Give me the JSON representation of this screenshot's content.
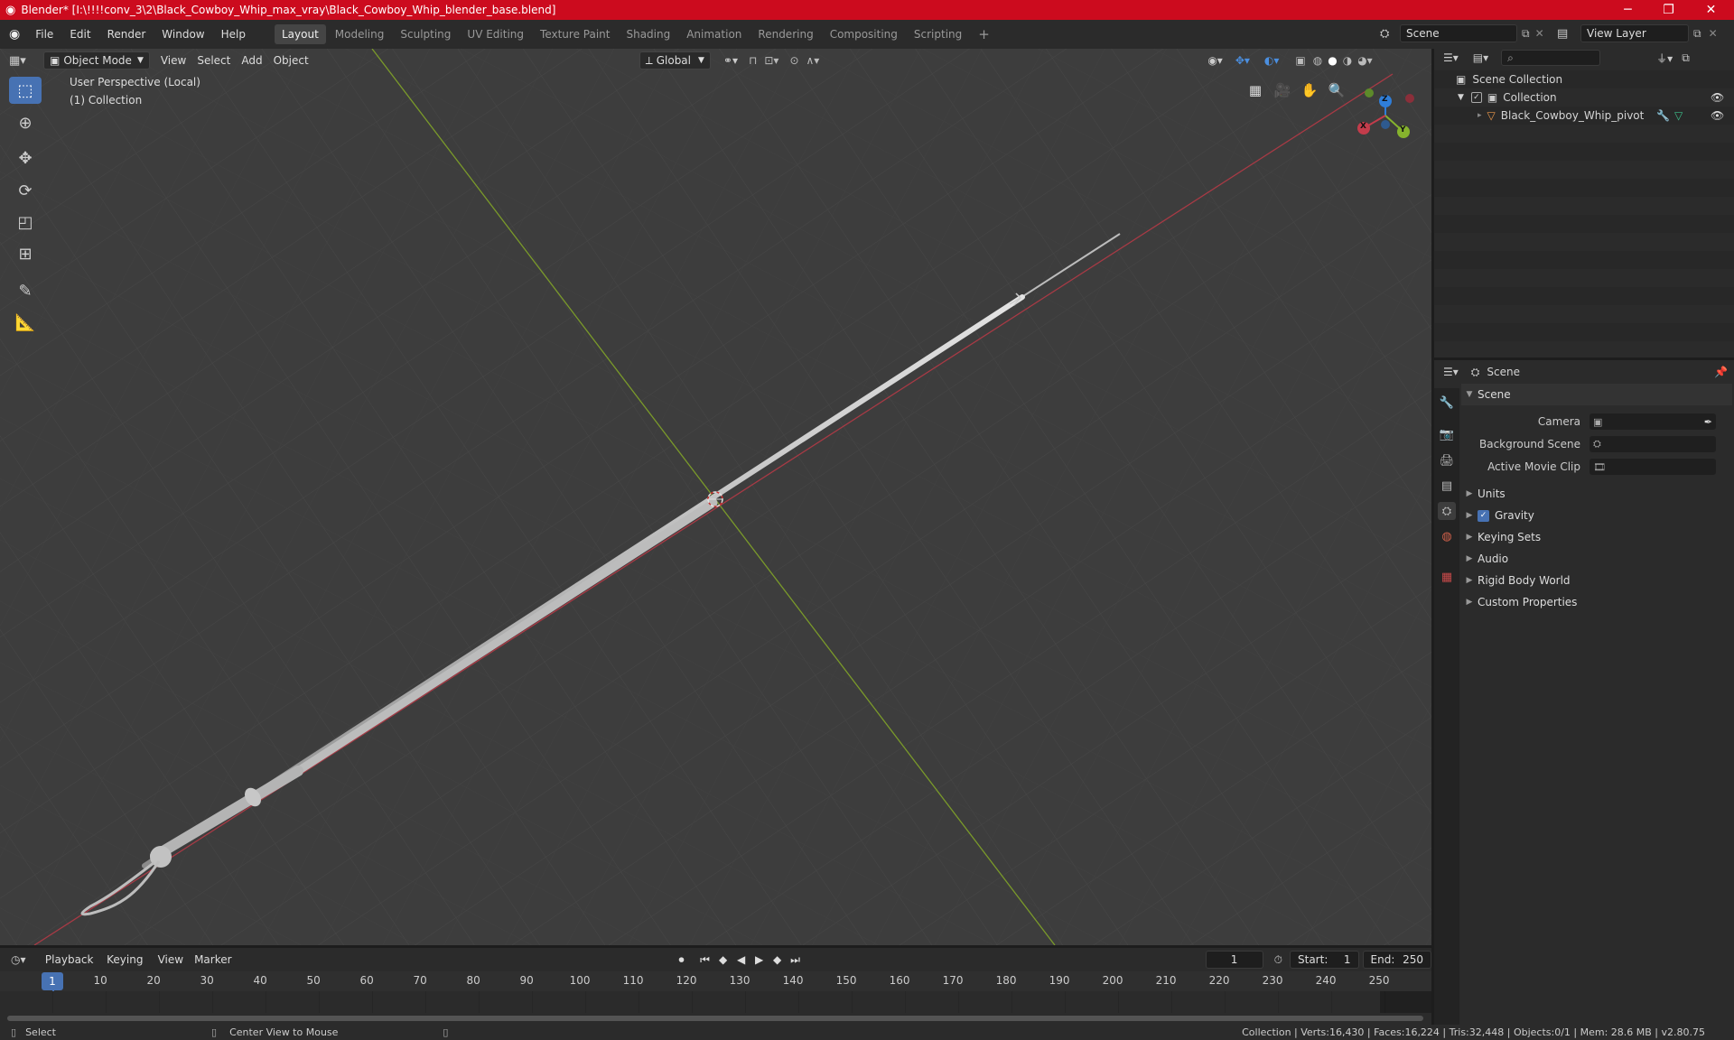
{
  "window": {
    "title": "Blender* [I:\\!!!!conv_3\\2\\Black_Cowboy_Whip_max_vray\\Black_Cowboy_Whip_blender_base.blend]",
    "minimize": "─",
    "maximize": "❐",
    "close": "✕"
  },
  "menus": [
    "File",
    "Edit",
    "Render",
    "Window",
    "Help"
  ],
  "workspaces": [
    "Layout",
    "Modeling",
    "Sculpting",
    "UV Editing",
    "Texture Paint",
    "Shading",
    "Animation",
    "Rendering",
    "Compositing",
    "Scripting"
  ],
  "active_workspace": "Layout",
  "add_workspace": "+",
  "scene_field": "Scene",
  "view_layer_field": "View Layer",
  "viewport": {
    "mode": "Object Mode",
    "menus": [
      "View",
      "Select",
      "Add",
      "Object"
    ],
    "transform_orientation": "Global",
    "overlay_line1": "User Perspective (Local)",
    "overlay_line2": "(1) Collection",
    "gizmo": {
      "x": "X",
      "y": "Y",
      "z": "Z"
    }
  },
  "outliner": {
    "search_placeholder": "",
    "root": "Scene Collection",
    "collection": "Collection",
    "object": "Black_Cowboy_Whip_pivot"
  },
  "properties": {
    "header": "Scene",
    "panel_title": "Scene",
    "camera_label": "Camera",
    "background_scene_label": "Background Scene",
    "active_movie_clip_label": "Active Movie Clip",
    "sections": [
      "Units",
      "Gravity",
      "Keying Sets",
      "Audio",
      "Rigid Body World",
      "Custom Properties"
    ]
  },
  "timeline": {
    "menus": [
      "Playback",
      "Keying",
      "View",
      "Marker"
    ],
    "current_frame": "1",
    "start_label": "Start:",
    "start_value": "1",
    "end_label": "End:",
    "end_value": "250",
    "playhead_label": "1",
    "ticks": [
      "10",
      "20",
      "30",
      "40",
      "50",
      "60",
      "70",
      "80",
      "90",
      "100",
      "110",
      "120",
      "130",
      "140",
      "150",
      "160",
      "170",
      "180",
      "190",
      "200",
      "210",
      "220",
      "230",
      "240",
      "250"
    ]
  },
  "statusbar": {
    "select": "Select",
    "center_view": "Center View to Mouse",
    "stats": "Collection | Verts:16,430 | Faces:16,224 | Tris:32,448 | Objects:0/1 | Mem: 28.6 MB | v2.80.75"
  },
  "colors": {
    "titlebar": "#cc0b1e",
    "accent": "#4772b3",
    "x_axis": "#c33c4b",
    "y_axis": "#86b32d",
    "z_axis": "#2f7ed8"
  }
}
